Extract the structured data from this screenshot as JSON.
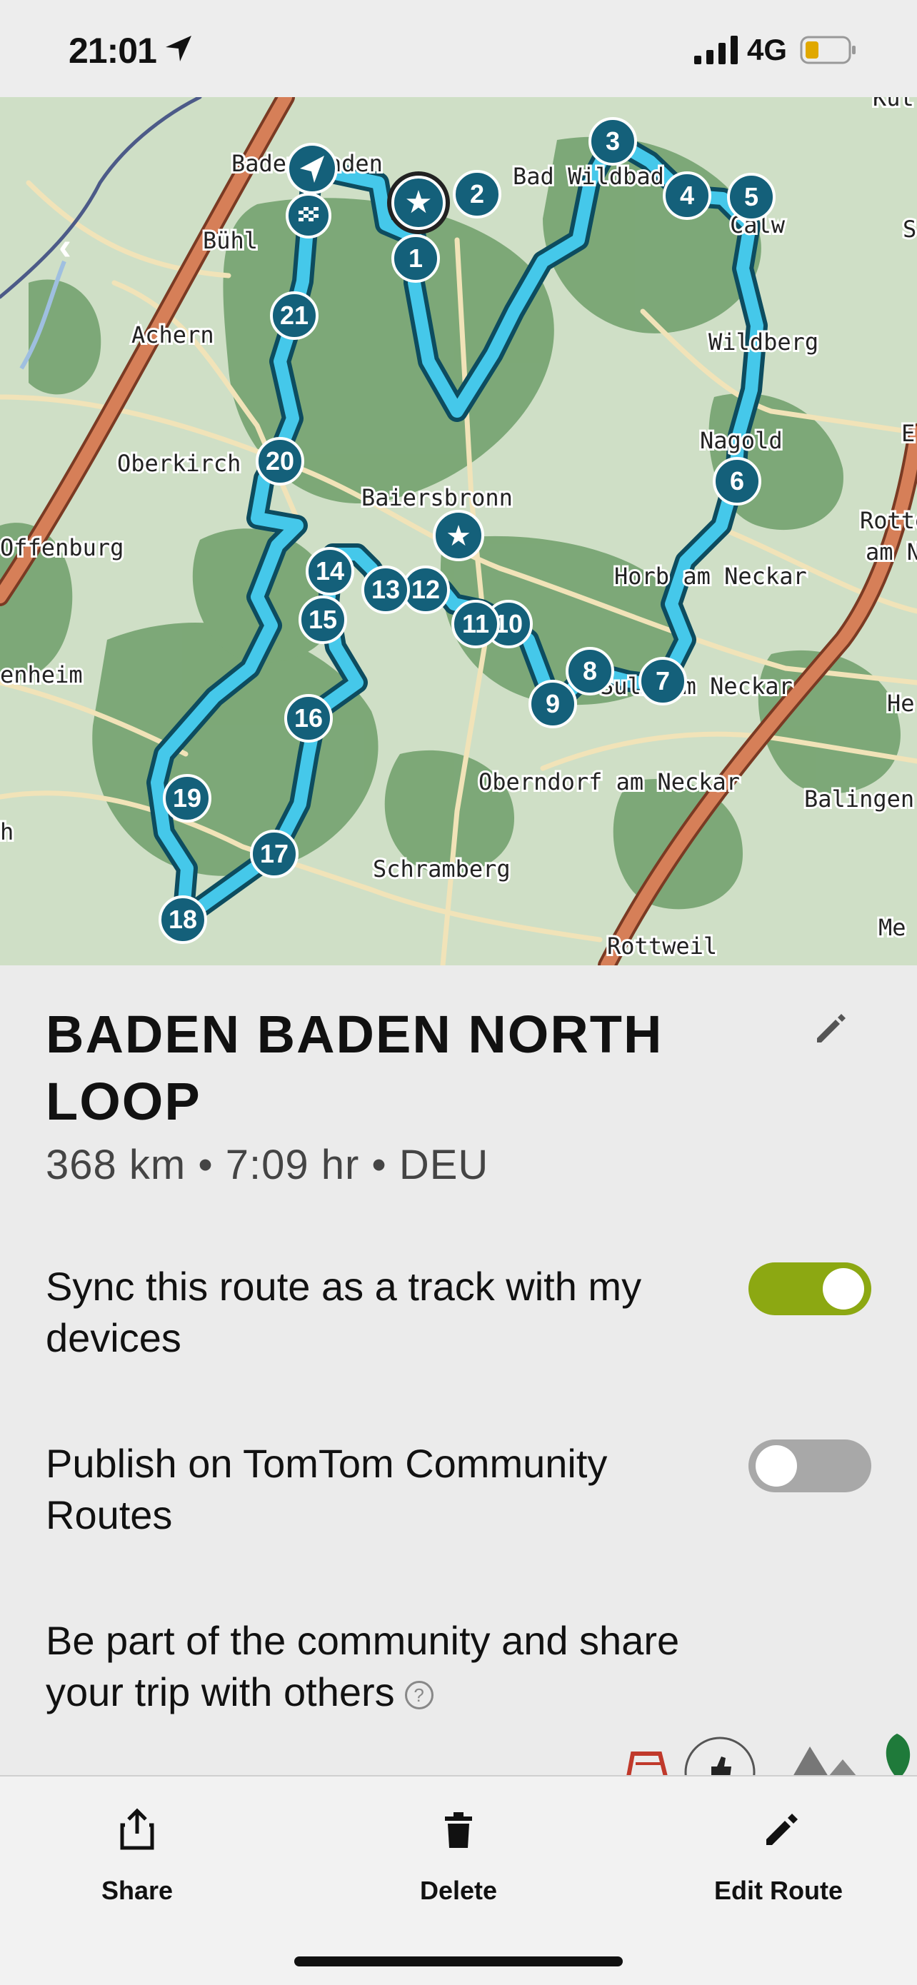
{
  "status_bar": {
    "time": "21:01",
    "network": "4G",
    "battery_color": "#e0a800"
  },
  "map": {
    "back_label": "‹",
    "towns": [
      "Baden-Baden",
      "Bühl",
      "Achern",
      "Oberkirch",
      "Offenburg",
      "enheim",
      "Bad Wildbad",
      "Calw",
      "Wildberg",
      "Nagold",
      "Baiersbronn",
      "Horb am Neckar",
      "Sulz am Neckar",
      "Oberndorf am Neckar",
      "Schramberg",
      "Rottweil",
      "Balingen",
      "Rotte",
      "am N",
      "He",
      "Me",
      "Kut",
      "E",
      "S",
      "h"
    ],
    "waypoints": [
      "1",
      "2",
      "3",
      "4",
      "5",
      "6",
      "7",
      "8",
      "9",
      "10",
      "11",
      "12",
      "13",
      "14",
      "15",
      "16",
      "17",
      "18",
      "19",
      "20",
      "21"
    ],
    "colors": {
      "route": "#45c8ea",
      "route_outline": "#0d4c5f",
      "marker": "#14607a"
    }
  },
  "route": {
    "title": "BADEN BADEN NORTH LOOP",
    "meta": "368 km • 7:09 hr • DEU"
  },
  "settings": {
    "sync_label": "Sync this route as a track with my devices",
    "sync_on": true,
    "publish_label": "Publish on TomTom Community Routes",
    "publish_on": false,
    "community_text": "Be part of the community and share your trip with others",
    "help_icon": "?"
  },
  "actions": {
    "share": "Share",
    "delete": "Delete",
    "edit": "Edit Route"
  }
}
